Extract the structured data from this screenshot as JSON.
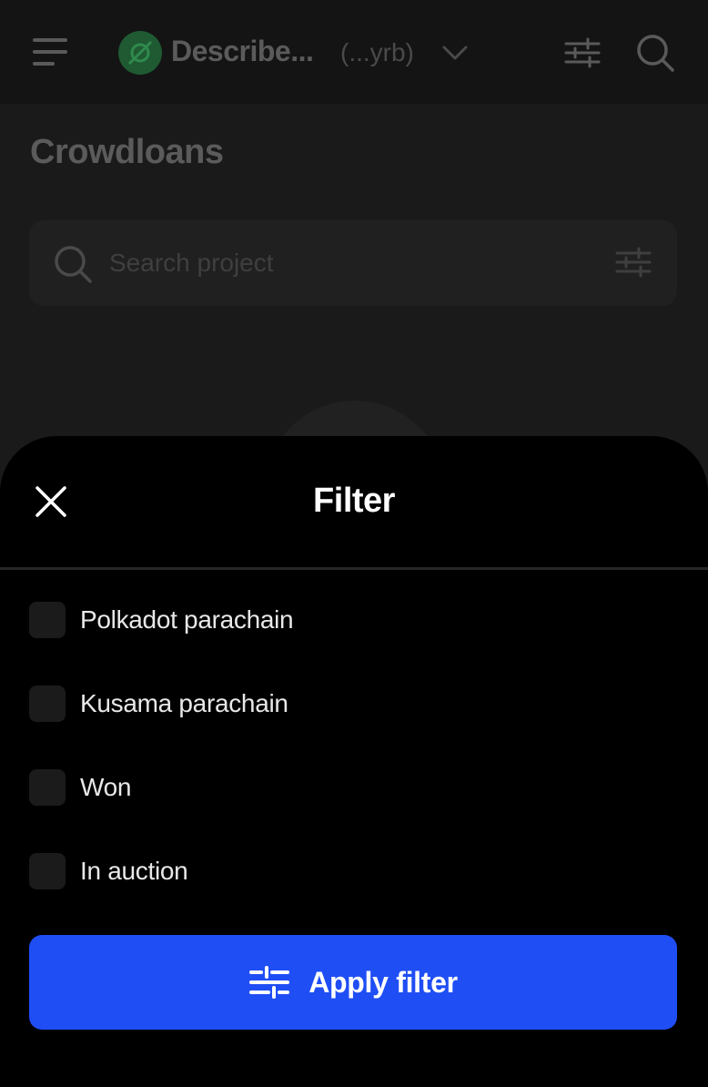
{
  "header": {
    "account_name": "Describe...",
    "account_address": "(...yrb)"
  },
  "page": {
    "title": "Crowdloans"
  },
  "search": {
    "placeholder": "Search project"
  },
  "filter_sheet": {
    "title": "Filter",
    "options": [
      {
        "label": "Polkadot parachain",
        "checked": false
      },
      {
        "label": "Kusama parachain",
        "checked": false
      },
      {
        "label": "Won",
        "checked": false
      },
      {
        "label": "In auction",
        "checked": false
      }
    ],
    "apply_label": "Apply filter"
  },
  "colors": {
    "accent": "#1f4ef5",
    "sheet_background": "#000000",
    "page_background": "#1a1a1a"
  },
  "icons": [
    "menu-icon",
    "account-avatar-icon",
    "chevron-down-icon",
    "filter-icon",
    "search-icon",
    "close-icon"
  ]
}
